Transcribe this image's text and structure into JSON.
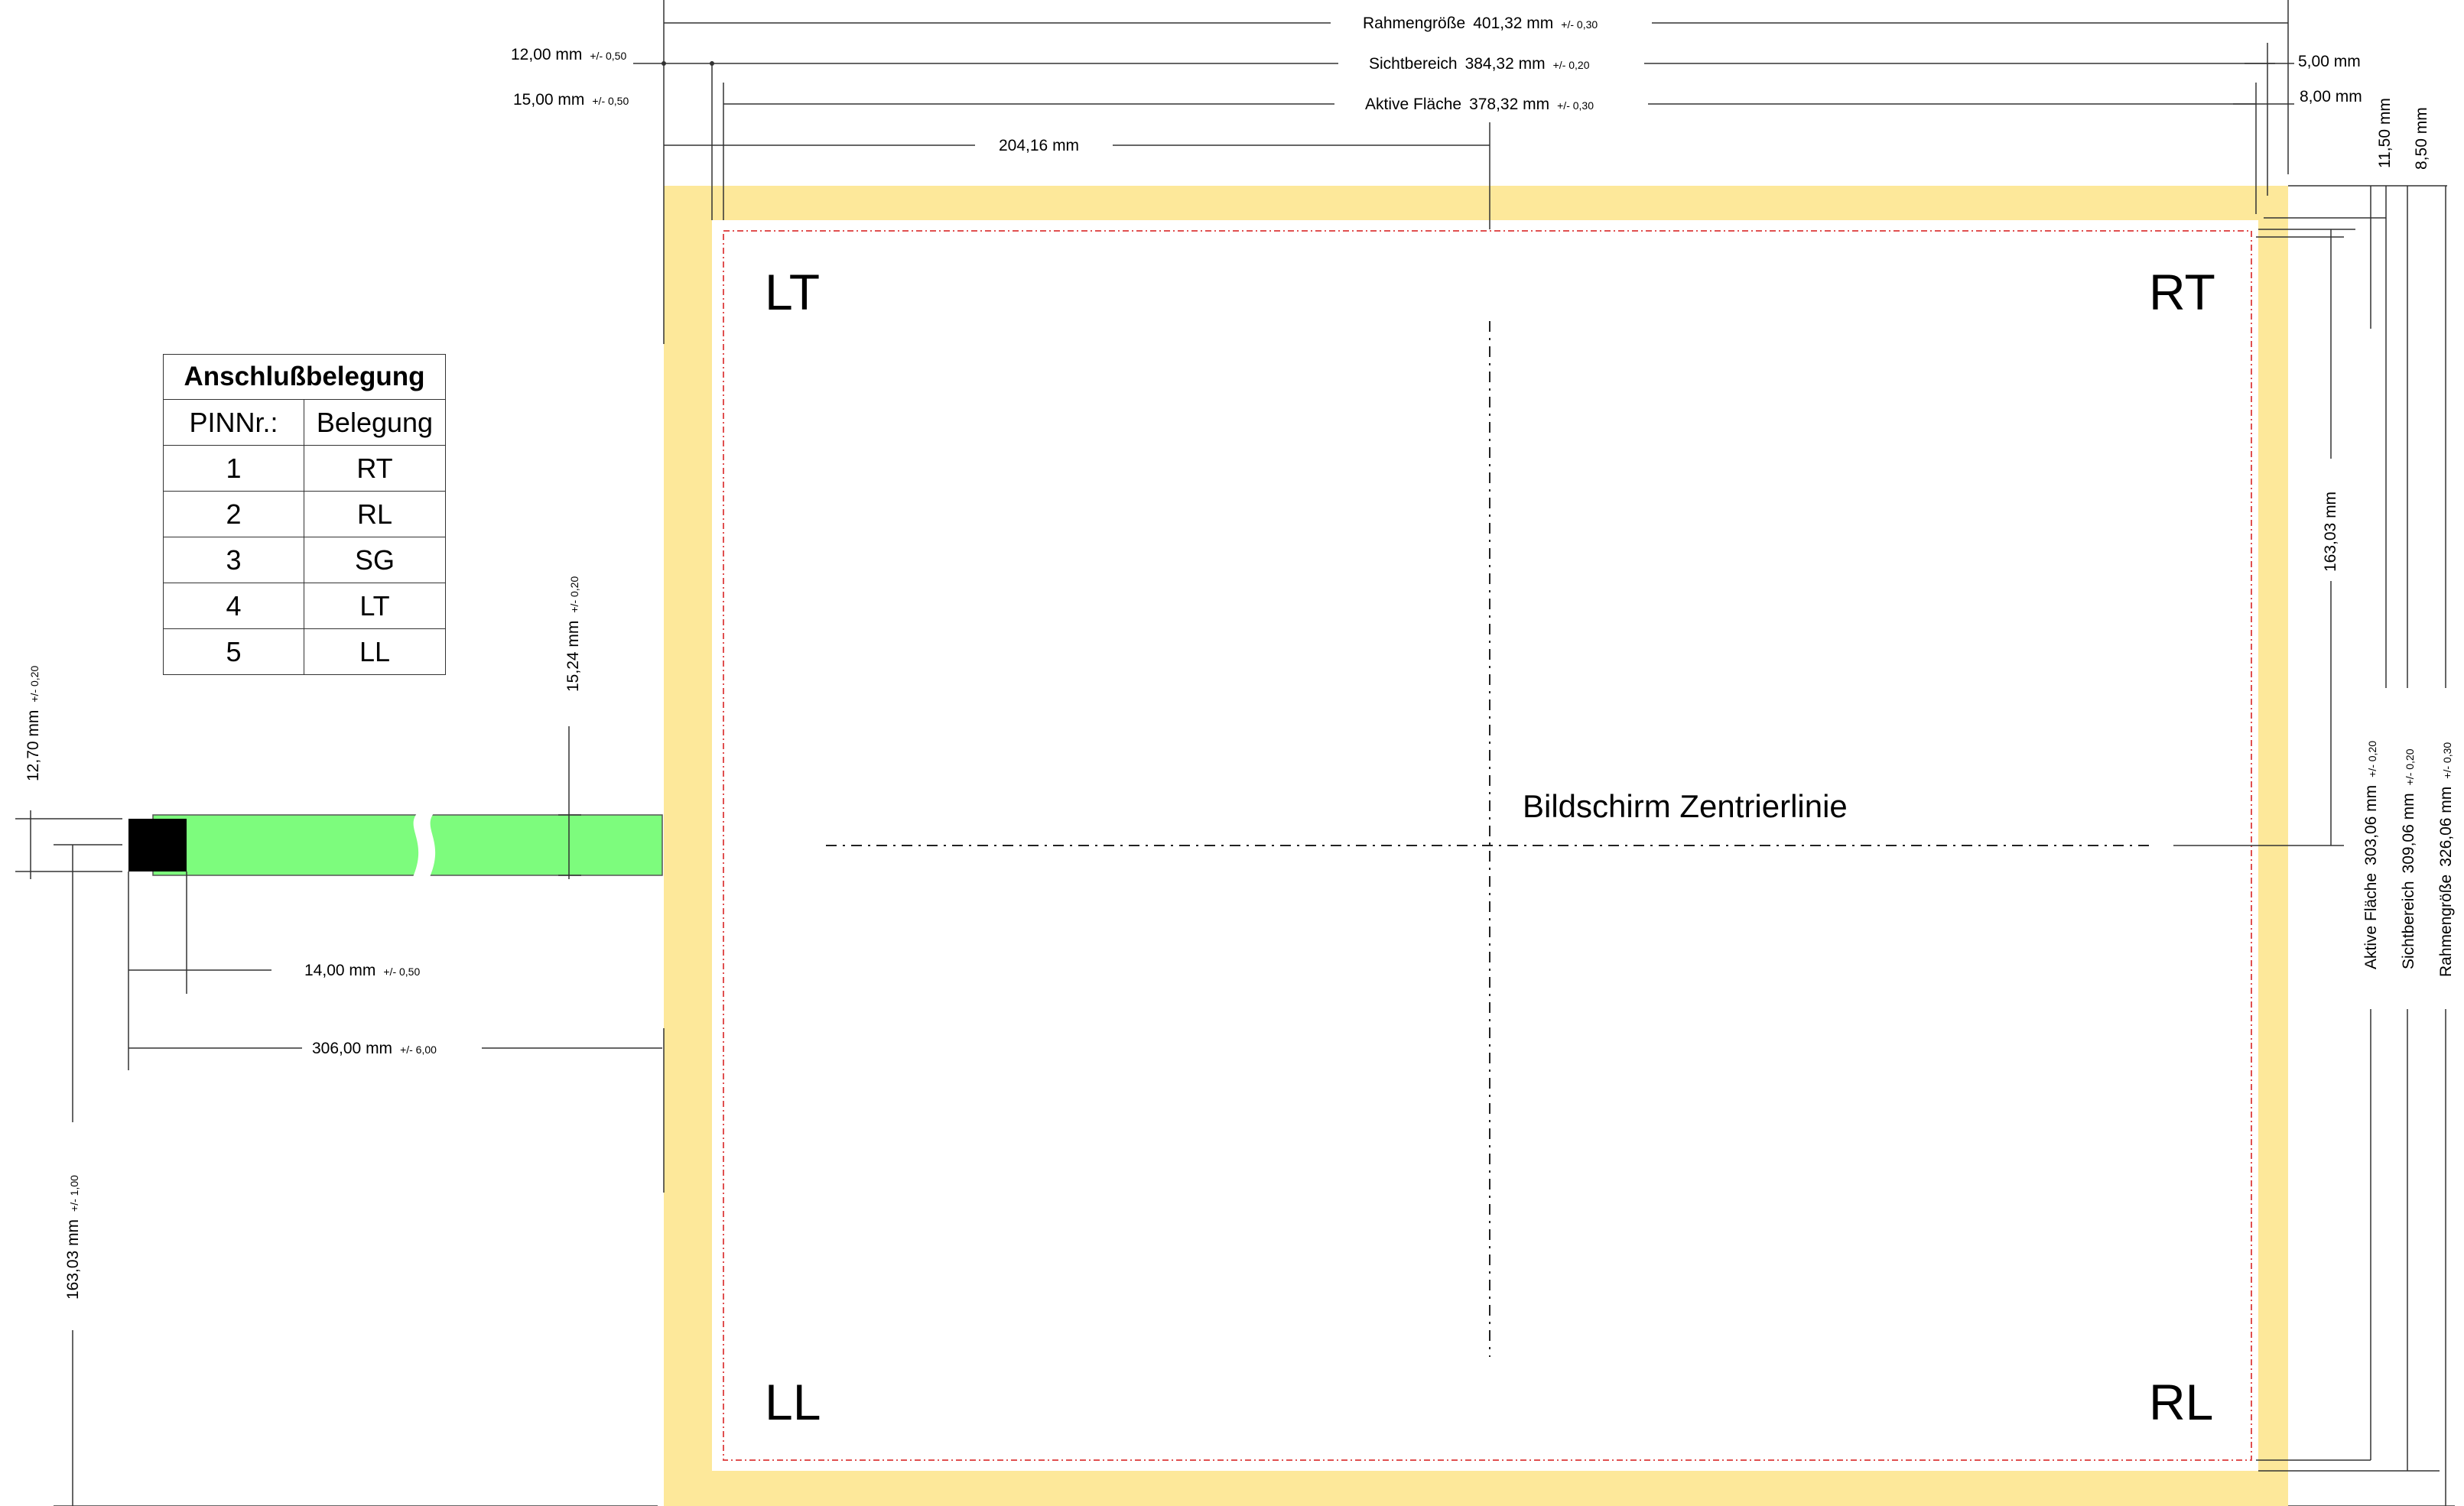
{
  "pin_table": {
    "title": "Anschlußbelegung",
    "col_pin": "PINNr.:",
    "col_assign": "Belegung",
    "rows": [
      {
        "pin": "1",
        "assign": "RT"
      },
      {
        "pin": "2",
        "assign": "RL"
      },
      {
        "pin": "3",
        "assign": "SG"
      },
      {
        "pin": "4",
        "assign": "LT"
      },
      {
        "pin": "5",
        "assign": "LL"
      }
    ]
  },
  "corners": {
    "lt": "LT",
    "rt": "RT",
    "ll": "LL",
    "rl": "RL"
  },
  "center_line_label": "Bildschirm Zentrierlinie",
  "dims": {
    "frame_width": {
      "label": "Rahmengröße",
      "value": "401,32 mm",
      "tol": "+/- 0,30"
    },
    "visible_width": {
      "label": "Sichtbereich",
      "value": "384,32 mm",
      "tol": "+/- 0,20"
    },
    "active_width": {
      "label": "Aktive Fläche",
      "value": "378,32 mm",
      "tol": "+/- 0,30"
    },
    "left_12": {
      "value": "12,00 mm",
      "tol": "+/- 0,50"
    },
    "left_15": {
      "value": "15,00 mm",
      "tol": "+/- 0,50"
    },
    "center_x": {
      "value": "204,16 mm"
    },
    "right_5": {
      "value": "5,00 mm"
    },
    "right_8": {
      "value": "8,00 mm"
    },
    "top_11_5": {
      "value": "11,50 mm"
    },
    "top_8_5": {
      "value": "8,50 mm"
    },
    "right_163": {
      "value": "163,03 mm"
    },
    "active_height": {
      "label": "Aktive Fläche",
      "value": "303,06 mm",
      "tol": "+/- 0,20"
    },
    "visible_height": {
      "label": "Sichtbereich",
      "value": "309,06 mm",
      "tol": "+/- 0,20"
    },
    "frame_height": {
      "label": "Rahmengröße",
      "value": "326,06 mm",
      "tol": "+/- 0,30"
    },
    "tail_width": {
      "value": "15,24 mm",
      "tol": "+/- 0,20"
    },
    "connector_width": {
      "value": "12,70 mm",
      "tol": "+/- 0,20"
    },
    "connector_len": {
      "value": "14,00 mm",
      "tol": "+/- 0,50"
    },
    "tail_len": {
      "value": "306,00 mm",
      "tol": "+/- 6,00"
    },
    "left_163": {
      "value": "163,03 mm",
      "tol": "+/- 1,00"
    }
  },
  "colors": {
    "frame": "#fde89a",
    "visible_area": "#ffffff",
    "active_border": "#e05050",
    "tail": "#7dfc7d",
    "connector": "#000000"
  }
}
